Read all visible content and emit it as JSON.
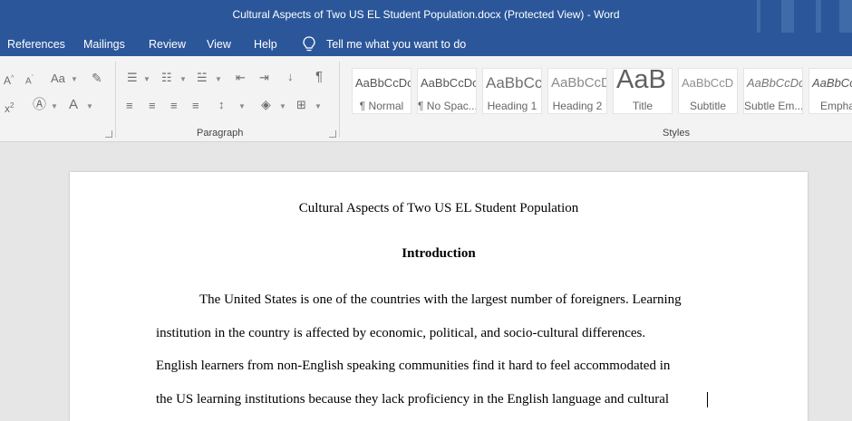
{
  "window": {
    "title": "Cultural Aspects of Two US EL Student Population.docx (Protected View)  -  Word"
  },
  "menu": {
    "items": [
      "References",
      "Mailings",
      "Review",
      "View",
      "Help"
    ],
    "tell_me": "Tell me what you want to do"
  },
  "ribbon": {
    "paragraph_label": "Paragraph",
    "styles_label": "Styles",
    "styles": [
      {
        "preview": "AaBbCcDc",
        "name": "¶ Normal"
      },
      {
        "preview": "AaBbCcDc",
        "name": "¶ No Spac..."
      },
      {
        "preview": "AaBbCc",
        "name": "Heading 1"
      },
      {
        "preview": "AaBbCcD",
        "name": "Heading 2"
      },
      {
        "preview": "AaB",
        "name": "Title"
      },
      {
        "preview": "AaBbCcD",
        "name": "Subtitle"
      },
      {
        "preview": "AaBbCcDc",
        "name": "Subtle Em..."
      },
      {
        "preview": "AaBbCcDc",
        "name": "Emphas"
      }
    ]
  },
  "document": {
    "title": "Cultural Aspects of Two US EL Student Population",
    "heading": "Introduction",
    "lines": [
      "The United States is one of the countries with the largest number of foreigners. Learning",
      "institution in the country is affected by economic, political, and socio-cultural differences.",
      "English learners from non-English speaking communities find it hard to feel accommodated in",
      "the US learning institutions because they lack proficiency in the English language and cultural"
    ]
  },
  "colors": {
    "title_bar": "#2b579a",
    "ribbon_bg": "#f3f3f3",
    "canvas_bg": "#e6e6e6"
  }
}
